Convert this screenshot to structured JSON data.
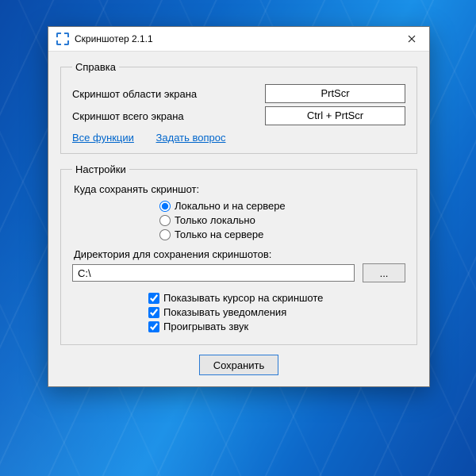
{
  "window": {
    "title": "Скриншотер 2.1.1"
  },
  "help": {
    "legend": "Справка",
    "area_label": "Скриншот области экрана",
    "area_key": "PrtScr",
    "full_label": "Скриншот всего экрана",
    "full_key": "Ctrl + PrtScr",
    "link_all": "Все функции",
    "link_ask": "Задать вопрос"
  },
  "settings": {
    "legend": "Настройки",
    "save_where_label": "Куда сохранять скриншот:",
    "radios": {
      "local_and_server": "Локально и на сервере",
      "local_only": "Только локально",
      "server_only": "Только на сервере",
      "selected": "local_and_server"
    },
    "dir_label": "Директория для сохранения скриншотов:",
    "dir_value": "C:\\",
    "browse_label": "...",
    "checks": {
      "show_cursor": {
        "label": "Показывать курсор на скриншоте",
        "checked": true
      },
      "show_notify": {
        "label": "Показывать уведомления",
        "checked": true
      },
      "play_sound": {
        "label": "Проигрывать звук",
        "checked": true
      }
    }
  },
  "save_button": "Сохранить"
}
